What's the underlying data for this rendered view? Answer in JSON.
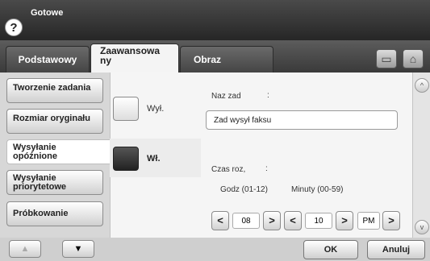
{
  "header": {
    "status": "Gotowe",
    "help_icon": "question-icon"
  },
  "tabs": [
    {
      "label": "Podstawowy"
    },
    {
      "label": "Zaawansowa",
      "label2": "ny"
    },
    {
      "label": "Obraz"
    }
  ],
  "top_icons": [
    "document-icon",
    "home-icon"
  ],
  "sidebar": {
    "items": [
      {
        "label": "Tworzenie zadania"
      },
      {
        "label": "Rozmiar oryginału"
      },
      {
        "label": "Wysyłanie",
        "label2": "opóźnione"
      },
      {
        "label": "Wysyłanie",
        "label2": "priorytetowe"
      },
      {
        "label": "Próbkowanie"
      }
    ],
    "nav_up": "▲",
    "nav_down": "▼"
  },
  "options": {
    "off_label": "Wył.",
    "on_label": "Wł."
  },
  "job_name": {
    "label": "Naz zad",
    "colon": ":",
    "value": "Zad wysył faksu"
  },
  "time": {
    "label": "Czas roz,",
    "colon": ":",
    "hours_label": "Godz (01-12)",
    "hours_value": "08",
    "minutes_label": "Minuty (00-59)",
    "minutes_value": "10",
    "ampm_value": "PM",
    "dec": "<",
    "inc": ">"
  },
  "footer": {
    "ok": "OK",
    "cancel": "Anuluj"
  },
  "scroll": {
    "up": "^",
    "down": "v"
  }
}
